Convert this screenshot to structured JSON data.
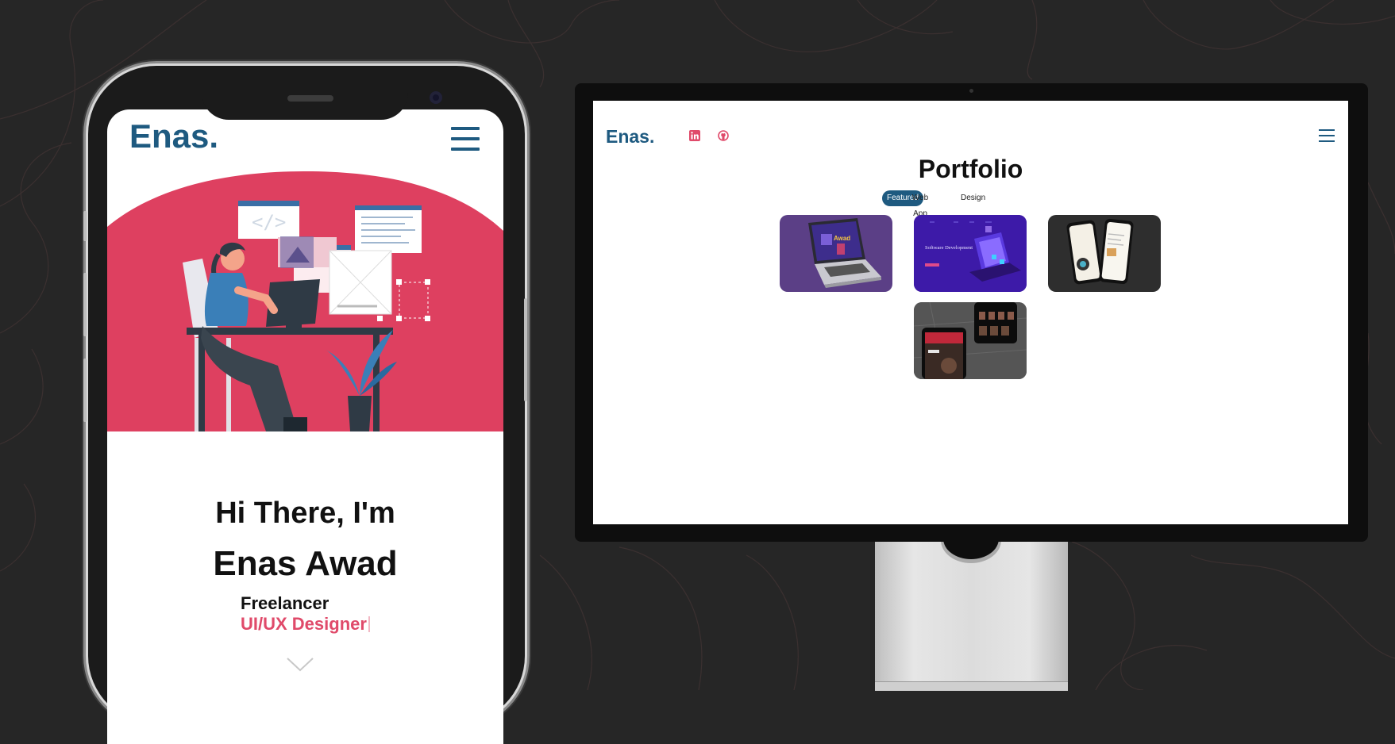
{
  "colors": {
    "brand": "#1e5a80",
    "accent": "#e04a6a",
    "background": "#262626"
  },
  "phone": {
    "logo": "Enas.",
    "menu_icon": "hamburger-menu-icon",
    "hero_icon": "developer-at-desk-illustration",
    "greeting": "Hi There, I'm",
    "name": "Enas Awad",
    "roles": [
      "Freelancer",
      "UI/UX Designer"
    ],
    "scroll_icon": "chevron-down-icon"
  },
  "desktop": {
    "logo": "Enas.",
    "social_icons": [
      "linkedin-icon",
      "github-icon"
    ],
    "menu_icon": "hamburger-menu-icon",
    "section_title": "Portfolio",
    "tabs": [
      {
        "label": "Featured",
        "active": true
      },
      {
        "label": "Web App",
        "active": false
      },
      {
        "label": "Design",
        "active": false
      }
    ],
    "portfolio_items": [
      {
        "thumbnail": "laptop-mockup",
        "text": "Awad"
      },
      {
        "thumbnail": "isometric-phone-mockup",
        "text": "Software Development"
      },
      {
        "thumbnail": "two-phones-mockup"
      },
      {
        "thumbnail": "movie-app-mockup"
      }
    ]
  }
}
